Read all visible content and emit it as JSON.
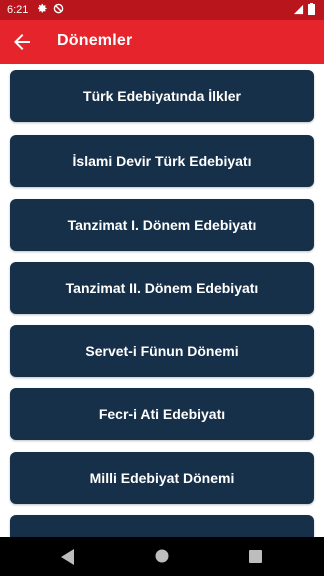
{
  "status_bar": {
    "time": "6:21",
    "icons": [
      "gear-icon",
      "do-not-disturb-icon",
      "signal-icon",
      "battery-icon"
    ]
  },
  "app_bar": {
    "title": "Dönemler",
    "back_icon": "arrow-back-icon",
    "background_color": "#e5242c"
  },
  "periods": [
    {
      "label": "Türk Edebiyatında İlkler"
    },
    {
      "label": "İslami Devir Türk Edebiyatı"
    },
    {
      "label": "Tanzimat I. Dönem Edebiyatı"
    },
    {
      "label": "Tanzimat II. Dönem Edebiyatı"
    },
    {
      "label": "Servet-i Fünun Dönemi"
    },
    {
      "label": "Fecr-i Ati Edebiyatı"
    },
    {
      "label": "Milli Edebiyat Dönemi"
    },
    {
      "label": ""
    }
  ],
  "colors": {
    "button": "#17304a",
    "status_bar": "#b8161c",
    "content_background": "#ffffff"
  },
  "nav_bar": {
    "icons": [
      "nav-back-icon",
      "nav-home-icon",
      "nav-recents-icon"
    ]
  }
}
